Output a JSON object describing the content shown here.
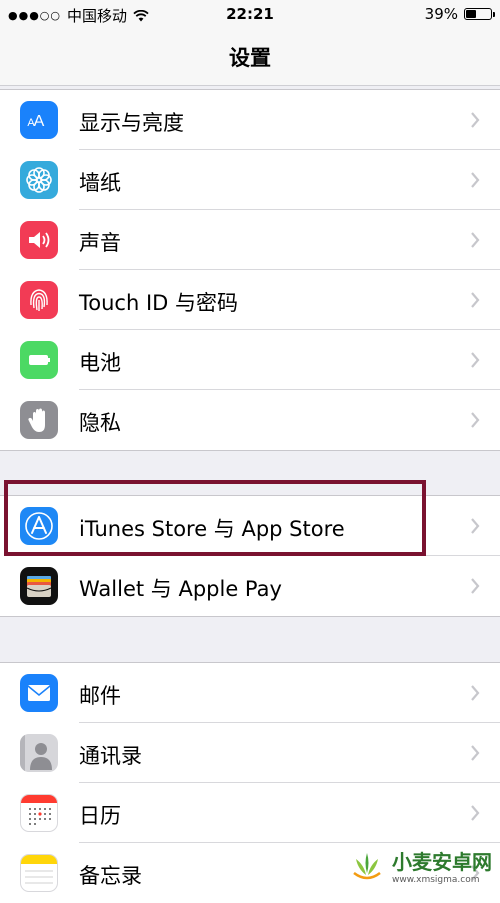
{
  "status_bar": {
    "carrier": "中国移动",
    "time": "22:21",
    "battery_percent": "39%",
    "battery_level": 0.39
  },
  "nav": {
    "title": "设置"
  },
  "groups": [
    {
      "items": [
        {
          "label": "显示与亮度",
          "icon": "display-brightness-icon",
          "color": "#1a82fb"
        },
        {
          "label": "墙纸",
          "icon": "wallpaper-icon",
          "color": "#35aadc"
        },
        {
          "label": "声音",
          "icon": "sound-icon",
          "color": "#f23b55"
        },
        {
          "label": "Touch ID 与密码",
          "icon": "fingerprint-icon",
          "color": "#f23b55"
        },
        {
          "label": "电池",
          "icon": "battery-icon",
          "color": "#4cd964"
        },
        {
          "label": "隐私",
          "icon": "privacy-hand-icon",
          "color": "#8e8e93"
        }
      ]
    },
    {
      "items": [
        {
          "label": "iTunes Store 与 App Store",
          "icon": "app-store-icon",
          "color": "#1e88f5"
        },
        {
          "label": "Wallet 与 Apple Pay",
          "icon": "wallet-icon",
          "color": "#111111"
        }
      ]
    },
    {
      "items": [
        {
          "label": "邮件",
          "icon": "mail-icon",
          "color": "#1a82fb"
        },
        {
          "label": "通讯录",
          "icon": "contacts-icon",
          "color": "#9b9ba0"
        },
        {
          "label": "日历",
          "icon": "calendar-icon",
          "color": "#ffffff"
        },
        {
          "label": "备忘录",
          "icon": "notes-icon",
          "color": "#ffd60a"
        }
      ]
    }
  ],
  "watermark": {
    "text": "小麦安卓网",
    "url": "www.xmsigma.com"
  }
}
